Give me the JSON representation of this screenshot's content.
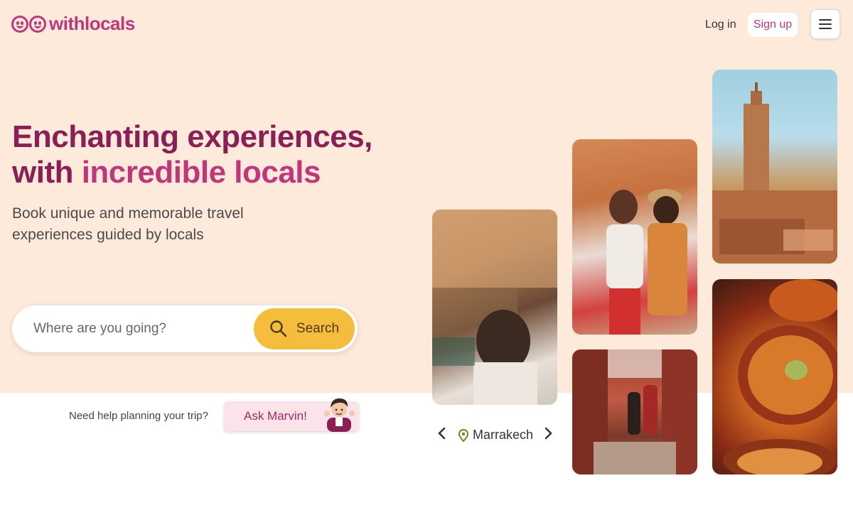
{
  "brand": {
    "name": "withlocals",
    "color": "#c0367b"
  },
  "header": {
    "login_label": "Log in",
    "signup_label": "Sign up"
  },
  "hero": {
    "headline_part1": "Enchanting experiences,",
    "headline_part2": "with ",
    "headline_highlight": "incredible locals",
    "subline": "Book unique and memorable travel experiences guided by locals"
  },
  "search": {
    "placeholder": "Where are you going?",
    "button_label": "Search",
    "button_color": "#f5bd3c"
  },
  "help": {
    "text": "Need help planning your trip?",
    "ask_label": "Ask Marvin!"
  },
  "carousel": {
    "location": "Marrakech",
    "images": [
      "carved-wall-photo",
      "market-street-photo",
      "koutoubia-tower-photo",
      "alley-photo",
      "tagine-food-photo"
    ]
  },
  "colors": {
    "hero_bg": "#fdeadb",
    "headline": "#8a1e55",
    "accent": "#c0367b"
  }
}
